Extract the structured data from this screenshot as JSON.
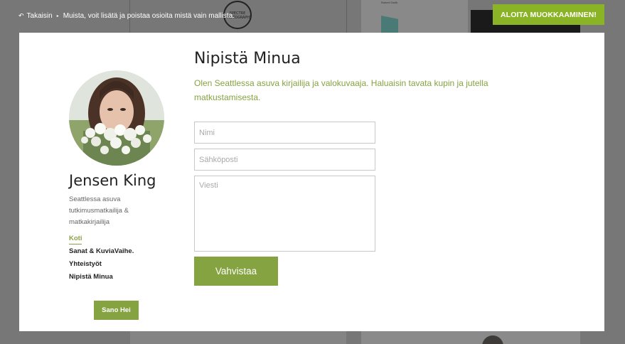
{
  "topbar": {
    "back_label": "Takaisin",
    "hint": "Muista, voit lisätä ja poistaa osioita mistä vain mallista.",
    "start_editing_label": "ALOITA MUOKKAAMINEN!"
  },
  "background": {
    "logo_text": "SPECTRE",
    "logo_subtext": "PHOTOGRAPHY",
    "thumb_name": "Robert Smith"
  },
  "profile": {
    "name": "Jensen King",
    "bio": "Seattlessa asuva tutkimusmatkailija & matkakirjailija",
    "nav": [
      {
        "label": "Koti",
        "active": true
      },
      {
        "label": "Sanat & KuviaVaihe.",
        "active": false
      },
      {
        "label": "Yhteistyöt",
        "active": false
      },
      {
        "label": "Nipistä Minua",
        "active": false
      }
    ],
    "hello_label": "Sano Hei"
  },
  "contact": {
    "title": "Nipistä Minua",
    "intro": "Olen Seattlessa asuva kirjailija ja valokuvaaja. Haluaisin tavata kupin ja jutella matkustamisesta.",
    "name_placeholder": "Nimi",
    "email_placeholder": "Sähköposti",
    "message_placeholder": "Viesti",
    "submit_label": "Vahvistaa"
  },
  "colors": {
    "accent": "#85a341",
    "start_button": "#8ab426"
  }
}
